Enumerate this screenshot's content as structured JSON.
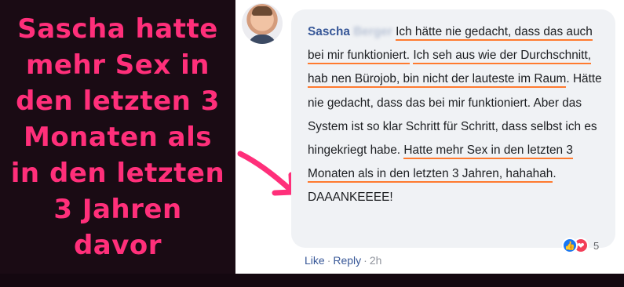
{
  "caption": {
    "lines": [
      "Sascha hatte",
      "mehr Sex in",
      "den letzten 3",
      "Monaten als",
      "in den letzten",
      "3 Jahren",
      "davor"
    ]
  },
  "comment": {
    "author_first": "Sascha",
    "author_last": "Berger",
    "segments": [
      {
        "text": "Ich hätte nie gedacht, dass das auch bei mir funktioniert.",
        "underline": true
      },
      {
        "text": " ",
        "underline": false
      },
      {
        "text": "Ich seh aus wie der Durchschnitt, hab nen Bürojob, bin nicht der lauteste im Raum",
        "underline": true
      },
      {
        "text": ". Hätte nie gedacht, dass das bei mir funktioniert. Aber das System ist so klar Schritt für Schritt, dass selbst ich es hingekriegt habe. ",
        "underline": false
      },
      {
        "text": "Hatte mehr Sex in den letzten 3 Monaten als in den letzten 3 Jahren, hahahah",
        "underline": true
      },
      {
        "text": ". DAAANKEEEE!",
        "underline": false
      }
    ],
    "reaction_count": "5",
    "actions": {
      "like": "Like",
      "reply": "Reply",
      "time": "2h"
    }
  },
  "colors": {
    "caption": "#ff2f7a",
    "underline": "#ff7a2f",
    "link": "#385898",
    "bubble": "#f0f2f5"
  },
  "icons": [
    "avatar-photo",
    "like-reaction-icon",
    "love-reaction-icon",
    "arrow-icon"
  ]
}
